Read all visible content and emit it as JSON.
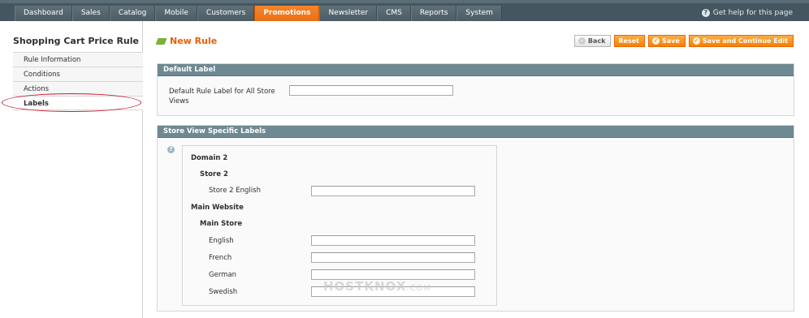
{
  "nav": {
    "items": [
      "Dashboard",
      "Sales",
      "Catalog",
      "Mobile",
      "Customers",
      "Promotions",
      "Newsletter",
      "CMS",
      "Reports",
      "System"
    ],
    "active": "Promotions",
    "help": "Get help for this page"
  },
  "sidebar": {
    "title": "Shopping Cart Price Rule",
    "tabs": [
      "Rule Information",
      "Conditions",
      "Actions",
      "Labels"
    ]
  },
  "header": {
    "title": "New Rule",
    "back": "Back",
    "reset": "Reset",
    "save": "Save",
    "save_continue": "Save and Continue Edit"
  },
  "default_label": {
    "heading": "Default Label",
    "field_label": "Default Rule Label for All Store Views",
    "value": ""
  },
  "store_labels": {
    "heading": "Store View Specific Labels",
    "domain": "Domain 2",
    "store": "Store 2",
    "store_view": "Store 2 English",
    "website": "Main Website",
    "main_store": "Main Store",
    "views": [
      "English",
      "French",
      "German",
      "Swedish"
    ]
  },
  "watermark": {
    "brand": "HOSTKNOX",
    "suffix": ".COM"
  },
  "colors": {
    "accent": "#eb5e00",
    "nav_active": "#f18200",
    "section_head": "#6f8992",
    "annotation": "#c31e2b"
  }
}
